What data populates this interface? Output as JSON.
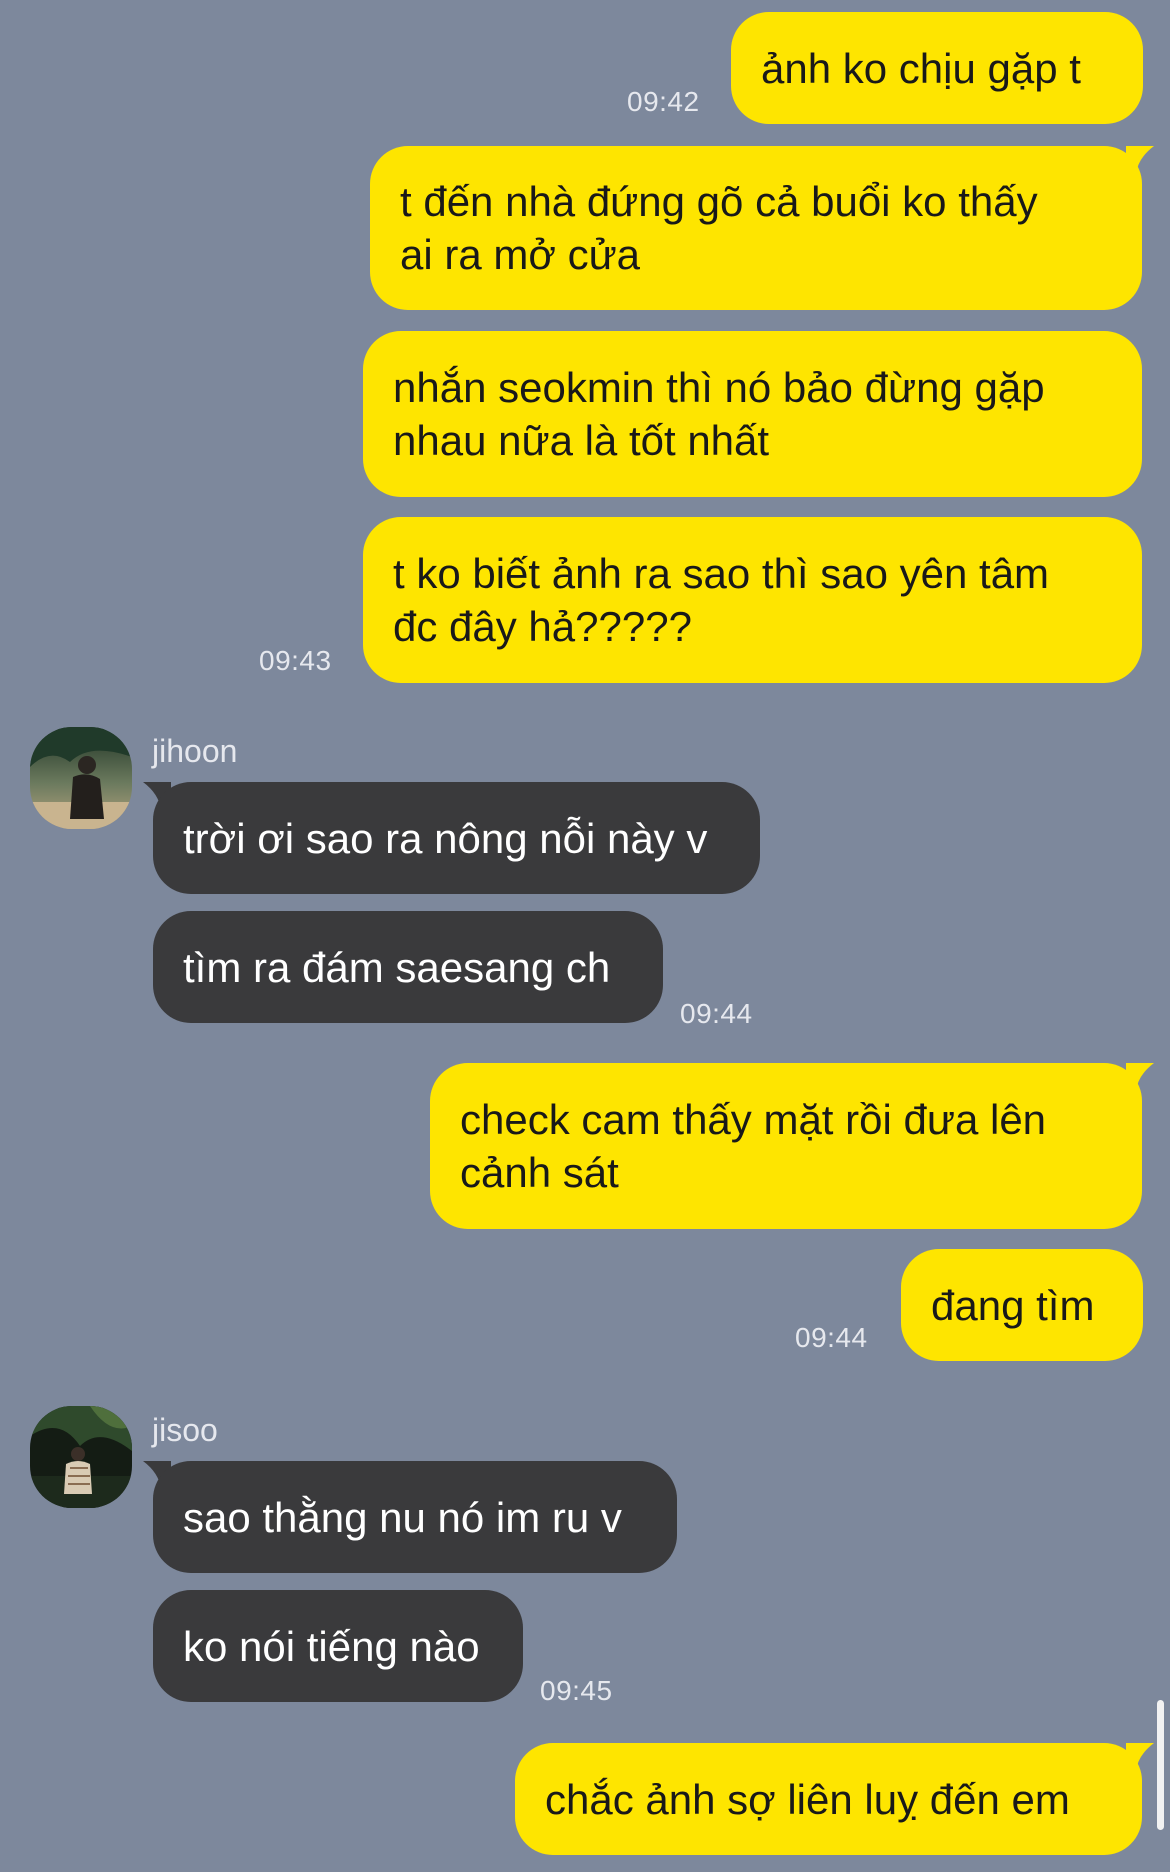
{
  "messages": [
    {
      "text": "ảnh ko chịu gặp t",
      "time": "09:42"
    },
    {
      "text": "t đến nhà đứng gõ cả buổi ko thấy\nai ra mở cửa"
    },
    {
      "text": "nhắn seokmin thì nó bảo đừng gặp\nnhau nữa là tốt nhất"
    },
    {
      "text": "t ko biết ảnh ra sao thì sao yên tâm\nđc đây hả?????",
      "time": "09:43"
    },
    {
      "sender": "jihoon",
      "text": "trời ơi sao ra nông nỗi này v"
    },
    {
      "text": "tìm ra đám saesang ch",
      "time": "09:44"
    },
    {
      "text": "check cam thấy mặt rồi đưa lên\ncảnh sát"
    },
    {
      "text": "đang tìm",
      "time": "09:44"
    },
    {
      "sender": "jisoo",
      "text": "sao thằng nu nó im ru v"
    },
    {
      "text": "ko nói tiếng nào",
      "time": "09:45"
    },
    {
      "text": "chắc ảnh sợ liên luỵ đến em"
    }
  ],
  "colors": {
    "background": "#7d889c",
    "outgoing_bubble": "#fee500",
    "incoming_bubble": "#3a3a3c"
  },
  "icons": [
    "avatar-jihoon",
    "avatar-jisoo",
    "scrollbar"
  ]
}
